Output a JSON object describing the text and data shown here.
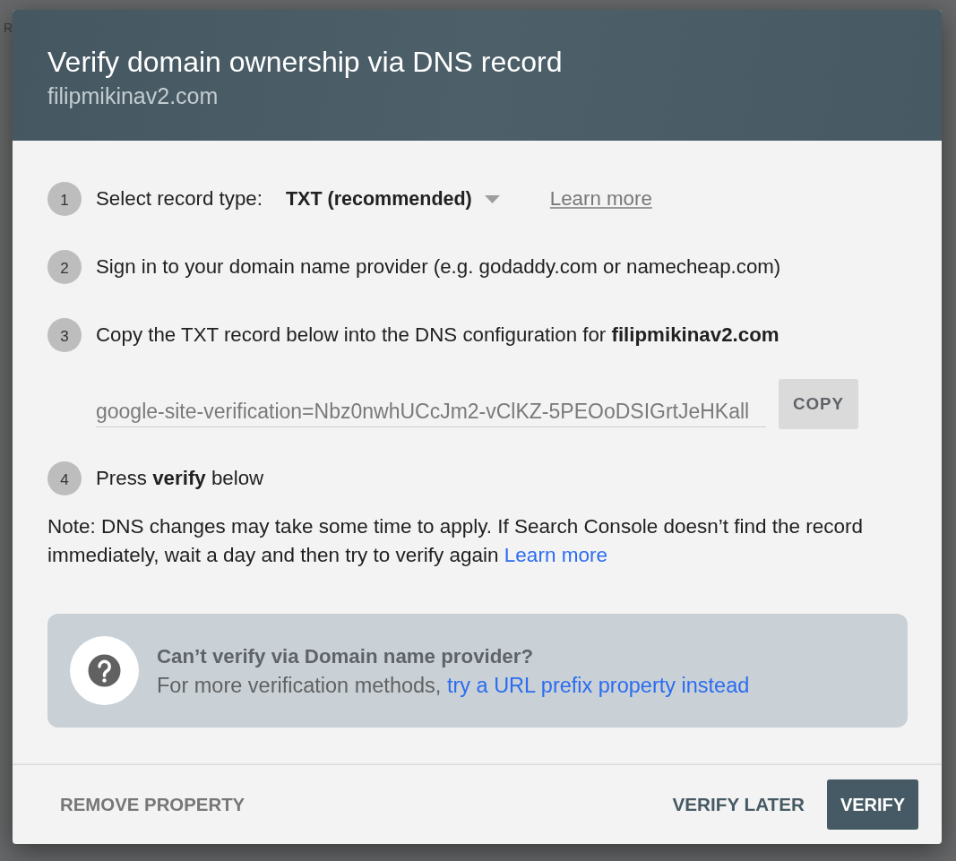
{
  "background_page": {
    "text_fragment": "R"
  },
  "dialog": {
    "title": "Verify domain ownership via DNS record",
    "subtitle": "filipmikinav2.com",
    "steps": [
      {
        "number": "1",
        "kind": "select",
        "label": "Select record type:",
        "dropdown": {
          "value": "TXT (recommended)"
        },
        "link": "Learn more"
      },
      {
        "number": "2",
        "kind": "text",
        "text": "Sign in to your domain name provider (e.g. godaddy.com or namecheap.com)"
      },
      {
        "number": "3",
        "kind": "record",
        "text": "Copy the TXT record below into the DNS configuration for **filipmikinav2.com**",
        "record": {
          "value": "google-site-verification=Nbz0nwhUCcJm2-vClKZ-5PEOoDSIGrtJeHKall",
          "button": "COPY"
        }
      },
      {
        "number": "4",
        "kind": "text",
        "text": "Press **verify** below"
      }
    ],
    "note": {
      "text": "Note: DNS changes may take some time to apply. If Search Console doesn’t find the record immediately, wait a day and then try to verify again",
      "link": "Learn more"
    },
    "help_box": {
      "title": "Can’t verify via Domain name provider?",
      "text": "For more verification methods,",
      "link": "try a URL prefix property instead"
    },
    "footer": {
      "remove_button": "REMOVE PROPERTY",
      "later_button": "VERIFY LATER",
      "verify_button": "VERIFY"
    }
  }
}
